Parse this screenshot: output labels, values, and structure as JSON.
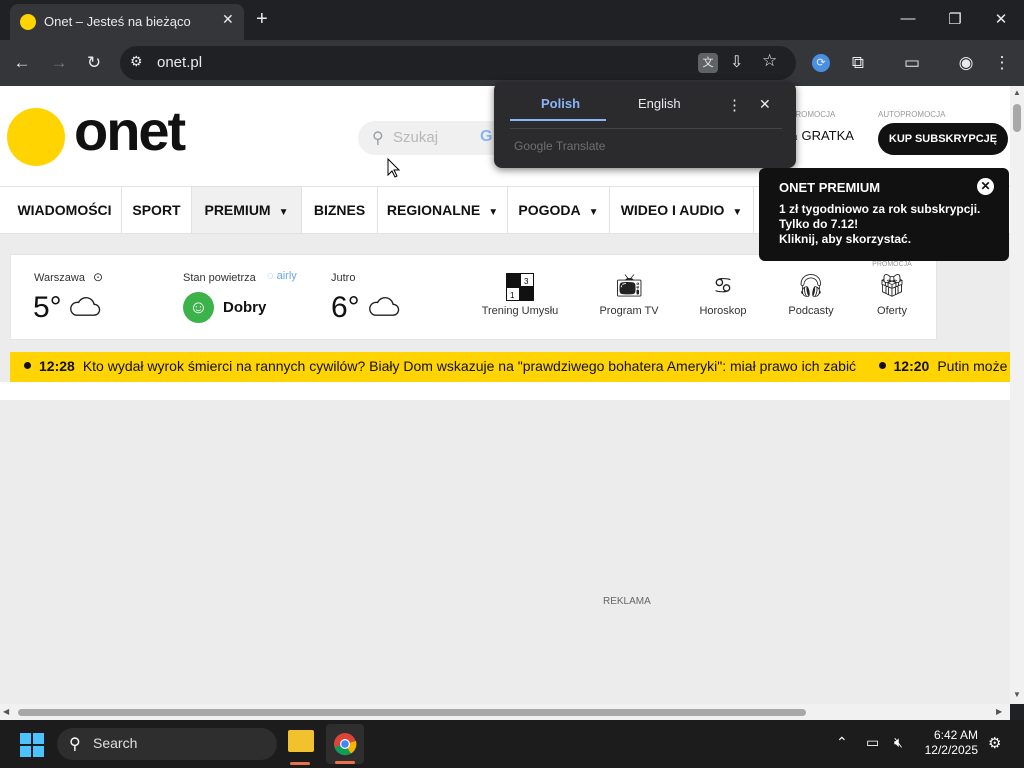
{
  "browser": {
    "tab_title": "Onet – Jesteś na bieżąco",
    "tab_favicon_color": "#ffd400",
    "new_tab_label": "+",
    "url": "onet.pl"
  },
  "site": {
    "logo_text": "onet",
    "search_placeholder": "Szukaj",
    "promo_label_1": "PROMOCJA",
    "promo_label_2": "AUTOPROMOCJA",
    "gratka_label": "GRATKA",
    "subscribe_button": "KUP SUBSKRYPCJĘ",
    "nav": [
      {
        "label": "WIADOMOŚCI",
        "dropdown": false
      },
      {
        "label": "SPORT",
        "dropdown": false
      },
      {
        "label": "PREMIUM",
        "dropdown": true
      },
      {
        "label": "BIZNES",
        "dropdown": false
      },
      {
        "label": "REGIONALNE",
        "dropdown": true
      },
      {
        "label": "POGODA",
        "dropdown": true
      },
      {
        "label": "WIDEO I AUDIO",
        "dropdown": true
      }
    ],
    "weather": {
      "city": "Warszawa",
      "temp_now": "5°",
      "air_label": "Stan powietrza",
      "air_brand": "airly",
      "air_status": "Dobry",
      "tomorrow_label": "Jutro",
      "temp_tomorrow": "6°"
    },
    "services": [
      {
        "label": "Trening Umysłu",
        "icon": "crossword-icon"
      },
      {
        "label": "Program TV",
        "icon": "tv-icon"
      },
      {
        "label": "Horoskop",
        "icon": "cancer-zodiac-icon"
      },
      {
        "label": "Podcasty",
        "icon": "headphones-icon"
      },
      {
        "label": "Oferty",
        "icon": "gift-icon",
        "badge": "PROMOCJA"
      }
    ],
    "ticker": [
      {
        "time": "12:28",
        "text": "Kto wydał wyrok śmierci na rannych cywilów? Biały Dom wskazuje na \"prawdziwego bohatera Ameryki\": miał prawo ich zabić"
      },
      {
        "time": "12:20",
        "text": "Putin może"
      }
    ],
    "ad_label": "REKLAMA",
    "premium_popup": {
      "title": "ONET PREMIUM",
      "line1": "1 zł tygodniowo za rok subskrypcji.",
      "line2": "Tylko do 7.12!",
      "line3": "Kliknij, aby skorzystać."
    }
  },
  "translate_popup": {
    "tab_source": "Polish",
    "tab_target": "English",
    "footer_brand": "Google",
    "footer_text": "Translate"
  },
  "taskbar": {
    "search_label": "Search",
    "time": "6:42 AM",
    "date": "12/2/2025"
  }
}
